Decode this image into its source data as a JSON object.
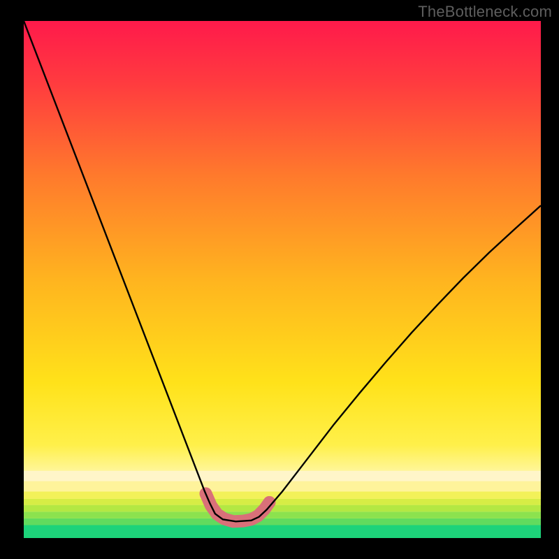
{
  "watermark": "TheBottleneck.com",
  "chart_data": {
    "type": "line",
    "title": "",
    "xlabel": "",
    "ylabel": "",
    "xlim": [
      0,
      100
    ],
    "ylim": [
      0,
      100
    ],
    "grid": false,
    "legend": false,
    "background_gradient": {
      "top_color": "#ff1a4b",
      "mid_color": "#ffe21a",
      "bottom_color": "#1dd37a"
    },
    "series": [
      {
        "name": "bottleneck-curve",
        "color": "#000000",
        "x": [
          0,
          5,
          10,
          15,
          20,
          25,
          27.5,
          30,
          32.5,
          35,
          36,
          37,
          38.5,
          41,
          44,
          45.5,
          47,
          50,
          55,
          60,
          65,
          70,
          75,
          80,
          85,
          90,
          95,
          100
        ],
        "y": [
          100,
          87,
          74,
          61,
          48,
          35,
          28.5,
          22,
          15.5,
          9,
          6.7,
          4.7,
          3.6,
          3.2,
          3.4,
          4.1,
          5.5,
          9.0,
          15.5,
          22,
          28.1,
          34,
          39.7,
          45.1,
          50.3,
          55.2,
          59.8,
          64.3
        ]
      },
      {
        "name": "highlight-band",
        "color": "#d97079",
        "stroke_width": 18,
        "linecap": "round",
        "x": [
          35.2,
          36.2,
          37.4,
          38.8,
          40.5,
          42.5,
          44.0,
          45.3,
          46.5,
          47.5
        ],
        "y": [
          8.6,
          6.3,
          4.6,
          3.7,
          3.2,
          3.3,
          3.6,
          4.3,
          5.5,
          6.9
        ]
      }
    ],
    "bottom_bands": [
      {
        "y0": 0.0,
        "y1": 2.5,
        "color": "#1dd37a"
      },
      {
        "y0": 2.5,
        "y1": 3.8,
        "color": "#61db5e"
      },
      {
        "y0": 3.8,
        "y1": 5.1,
        "color": "#8ce24e"
      },
      {
        "y0": 5.1,
        "y1": 6.4,
        "color": "#b3e843"
      },
      {
        "y0": 6.4,
        "y1": 7.6,
        "color": "#d6ed45"
      },
      {
        "y0": 7.6,
        "y1": 9.0,
        "color": "#f2f159"
      },
      {
        "y0": 9.0,
        "y1": 11.0,
        "color": "#fef39b"
      },
      {
        "y0": 11.0,
        "y1": 13.0,
        "color": "#fff5c9"
      }
    ]
  }
}
